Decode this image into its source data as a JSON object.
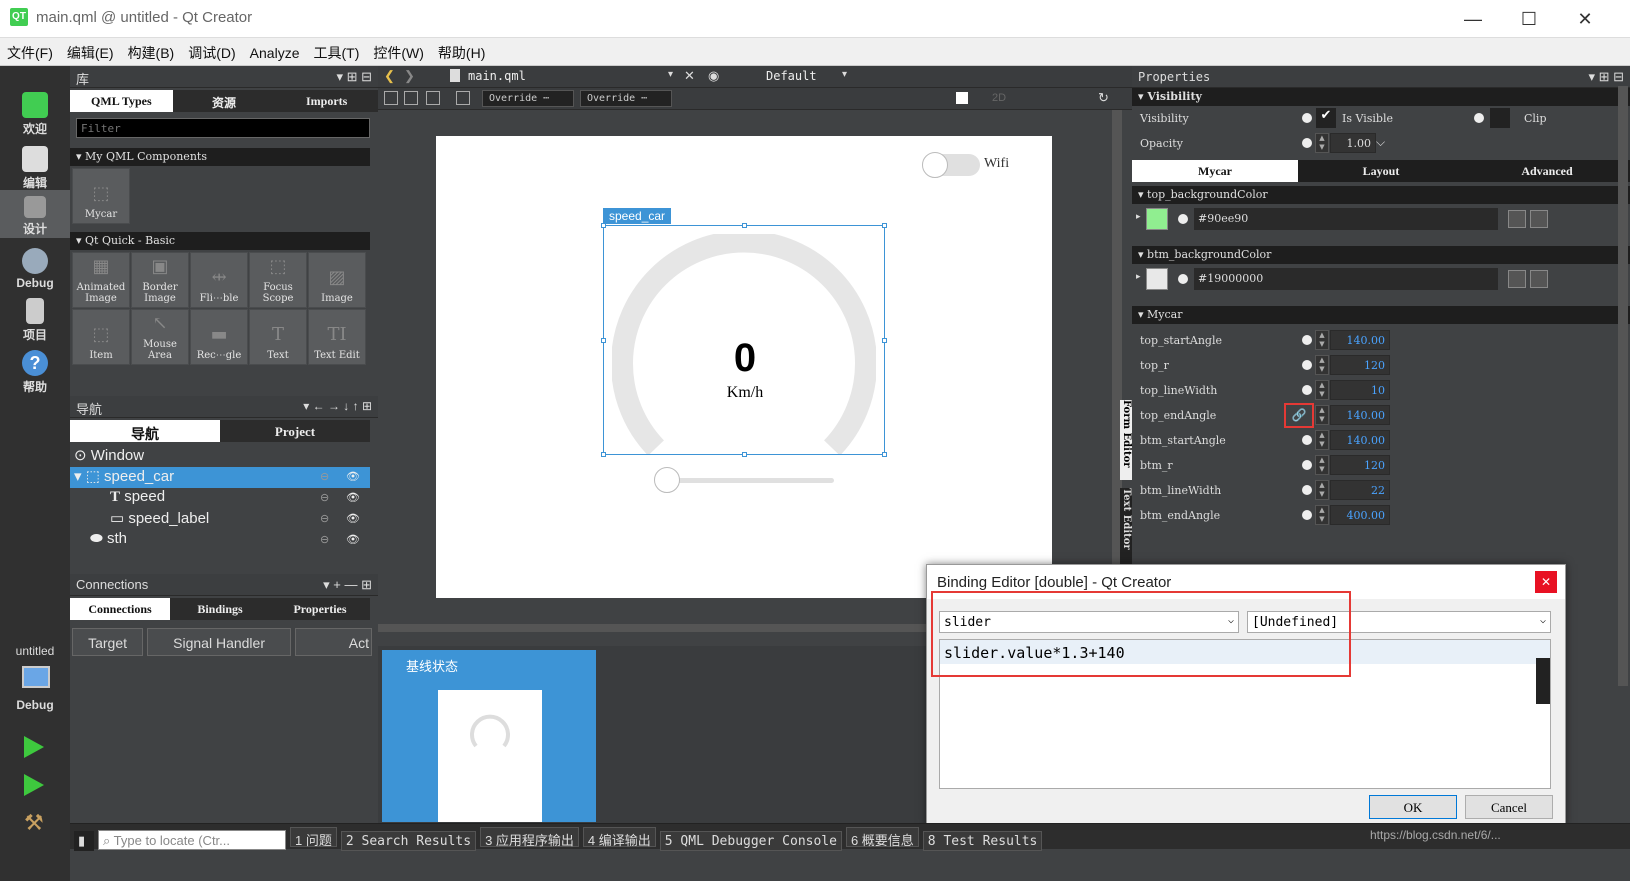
{
  "window": {
    "title": "main.qml @ untitled - Qt Creator",
    "logo": "QT"
  },
  "menu": [
    "文件(F)",
    "编辑(E)",
    "构建(B)",
    "调试(D)",
    "Analyze",
    "工具(T)",
    "控件(W)",
    "帮助(H)"
  ],
  "modes": [
    {
      "label": "欢迎",
      "icon": "qt-welcome-icon"
    },
    {
      "label": "编辑",
      "icon": "edit-icon"
    },
    {
      "label": "设计",
      "icon": "design-icon"
    },
    {
      "label": "Debug",
      "icon": "debug-icon"
    },
    {
      "label": "项目",
      "icon": "projects-icon"
    },
    {
      "label": "帮助",
      "icon": "help-icon"
    }
  ],
  "kit": {
    "project": "untitled",
    "config": "Debug"
  },
  "library": {
    "title": "库",
    "tabs": [
      "QML Types",
      "资源",
      "Imports"
    ],
    "filter_placeholder": "Filter",
    "sections": [
      {
        "name": "My QML Components",
        "items": [
          "Mycar"
        ]
      },
      {
        "name": "Qt Quick - Basic",
        "items": [
          "Animated Image",
          "Border Image",
          "Fli⋯ble",
          "Focus Scope",
          "Image",
          "Item",
          "Mouse Area",
          "Rec⋯gle",
          "Text",
          "Text Edit"
        ]
      }
    ]
  },
  "navigator": {
    "title": "导航",
    "tabs": [
      "导航",
      "Project"
    ],
    "tree": [
      "Window",
      "speed_car",
      "speed",
      "speed_label",
      "sth"
    ]
  },
  "connections": {
    "title": "Connections",
    "tabs": [
      "Connections",
      "Bindings",
      "Properties"
    ],
    "columns": [
      "Target",
      "Signal Handler",
      "Act"
    ]
  },
  "editor": {
    "file": "main.qml",
    "config": "Default",
    "override1": "Override ⋯",
    "override2": "Override ⋯",
    "mode2d": "2D"
  },
  "canvas": {
    "wifi": "Wifi",
    "component_label": "speed_car",
    "speed_value": "0",
    "speed_unit": "Km/h",
    "form_editor": "Form Editor",
    "text_editor": "Text Editor"
  },
  "states": {
    "base": "基线状态"
  },
  "properties": {
    "title": "Properties",
    "visibility_section": "Visibility",
    "visibility_label": "Visibility",
    "is_visible": "Is Visible",
    "clip": "Clip",
    "opacity_label": "Opacity",
    "opacity": "1.00",
    "tabs": [
      "Mycar",
      "Layout",
      "Advanced"
    ],
    "top_bg_section": "top_backgroundColor",
    "top_bg_value": "#90ee90",
    "top_bg_color": "#90ee90",
    "btm_bg_section": "btm_backgroundColor",
    "btm_bg_value": "#19000000",
    "btm_bg_color": "#e8e8e8",
    "mycar_section": "Mycar",
    "rows": [
      {
        "label": "top_startAngle",
        "value": "140.00"
      },
      {
        "label": "top_r",
        "value": "120"
      },
      {
        "label": "top_lineWidth",
        "value": "10"
      },
      {
        "label": "top_endAngle",
        "value": "140.00"
      },
      {
        "label": "btm_startAngle",
        "value": "140.00"
      },
      {
        "label": "btm_r",
        "value": "120"
      },
      {
        "label": "btm_lineWidth",
        "value": "22"
      },
      {
        "label": "btm_endAngle",
        "value": "400.00"
      }
    ]
  },
  "binding": {
    "title": "Binding Editor [double] - Qt Creator",
    "target": "slider",
    "property": "[Undefined]",
    "expression": "slider.value*1.3+140",
    "ok": "OK",
    "cancel": "Cancel"
  },
  "statusbar": {
    "locate_placeholder": "Type to locate (Ctr...",
    "items": [
      "1 问题",
      "2 Search Results",
      "3 应用程序输出",
      "4 编译输出",
      "5 QML Debugger Console",
      "6 概要信息",
      "8 Test Results"
    ],
    "watermark": "https://blog.csdn.net/6/..."
  }
}
